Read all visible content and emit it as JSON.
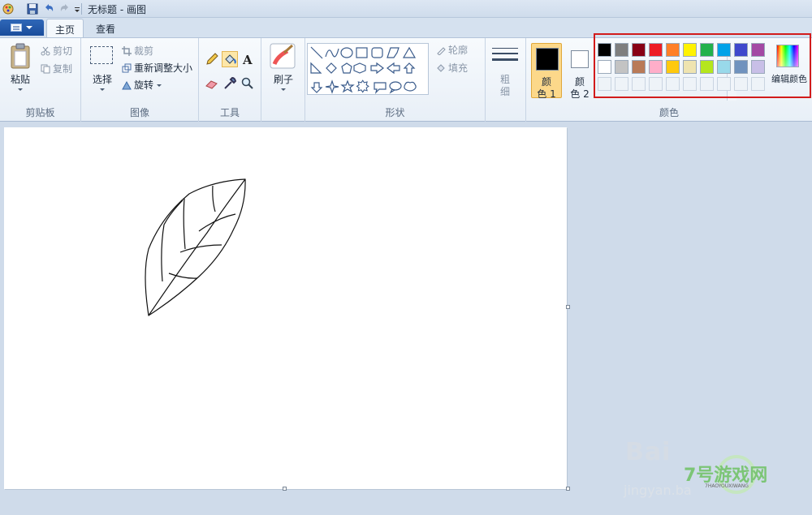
{
  "title": "无标题 - 画图",
  "tabs": {
    "home": "主页",
    "view": "查看"
  },
  "clipboard": {
    "paste": "粘贴",
    "cut": "剪切",
    "copy": "复制",
    "label": "剪贴板"
  },
  "image": {
    "select": "选择",
    "crop": "裁剪",
    "resize": "重新调整大小",
    "rotate": "旋转",
    "label": "图像"
  },
  "tools": {
    "label": "工具"
  },
  "brushes": {
    "label": "刷子"
  },
  "shapes": {
    "outline": "轮廓",
    "fill": "填充",
    "label": "形状"
  },
  "size": {
    "label_1": "粗",
    "label_2": "细"
  },
  "colors": {
    "color1_l1": "颜",
    "color1_l2": "色 1",
    "color2_l1": "颜",
    "color2_l2": "色 2",
    "edit": "编辑颜色",
    "label": "颜色",
    "color1_value": "#000000",
    "color2_value": "#ffffff",
    "row1": [
      "#000000",
      "#7f7f7f",
      "#880015",
      "#ed1c24",
      "#ff7f27",
      "#fff200",
      "#22b14c",
      "#00a2e8",
      "#3f48cc",
      "#a349a4"
    ],
    "row2": [
      "#ffffff",
      "#c3c3c3",
      "#b97a57",
      "#ffaec9",
      "#ffc90e",
      "#efe4b0",
      "#b5e61d",
      "#99d9ea",
      "#7092be",
      "#c8bfe7"
    ]
  },
  "watermark": {
    "main": "Bai",
    "sub": "jingyan.ba",
    "badge_main": "7号游戏网",
    "badge_sub": "7HAOYOUXIWANG"
  }
}
